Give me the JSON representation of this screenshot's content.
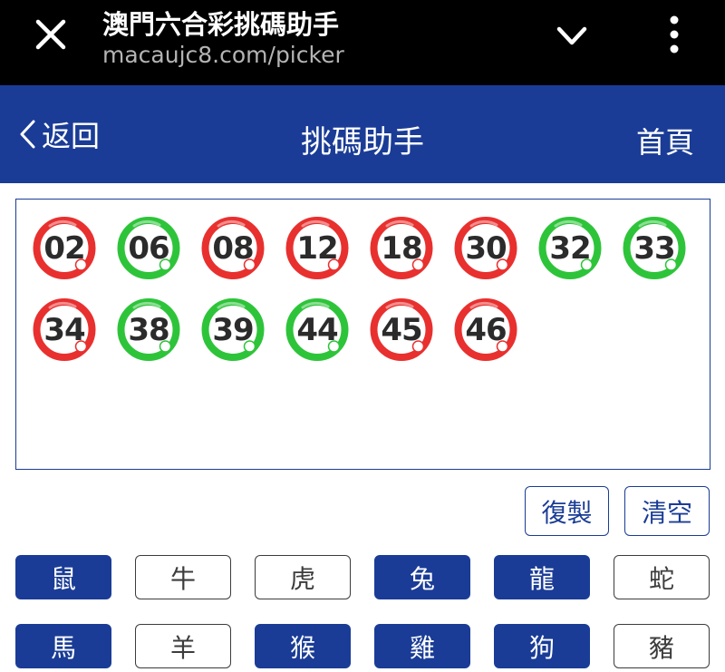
{
  "browser": {
    "title": "澳門六合彩挑碼助手",
    "url": "macaujc8.com/picker"
  },
  "header": {
    "back_label": "返回",
    "title": "挑碼助手",
    "home_label": "首頁"
  },
  "colors": {
    "primary": "#1a3c96",
    "ball_red": "#e8302f",
    "ball_green": "#2ec43a"
  },
  "balls": [
    {
      "number": "02",
      "color": "red"
    },
    {
      "number": "06",
      "color": "green"
    },
    {
      "number": "08",
      "color": "red"
    },
    {
      "number": "12",
      "color": "red"
    },
    {
      "number": "18",
      "color": "red"
    },
    {
      "number": "30",
      "color": "red"
    },
    {
      "number": "32",
      "color": "green"
    },
    {
      "number": "33",
      "color": "green"
    },
    {
      "number": "34",
      "color": "red"
    },
    {
      "number": "38",
      "color": "green"
    },
    {
      "number": "39",
      "color": "green"
    },
    {
      "number": "44",
      "color": "green"
    },
    {
      "number": "45",
      "color": "red"
    },
    {
      "number": "46",
      "color": "red"
    }
  ],
  "actions": {
    "copy_label": "復製",
    "clear_label": "清空"
  },
  "zodiac": [
    {
      "label": "鼠",
      "selected": true
    },
    {
      "label": "牛",
      "selected": false
    },
    {
      "label": "虎",
      "selected": false
    },
    {
      "label": "兔",
      "selected": true
    },
    {
      "label": "龍",
      "selected": true
    },
    {
      "label": "蛇",
      "selected": false
    },
    {
      "label": "馬",
      "selected": true
    },
    {
      "label": "羊",
      "selected": false
    },
    {
      "label": "猴",
      "selected": true
    },
    {
      "label": "雞",
      "selected": true
    },
    {
      "label": "狗",
      "selected": true
    },
    {
      "label": "豬",
      "selected": false
    }
  ]
}
